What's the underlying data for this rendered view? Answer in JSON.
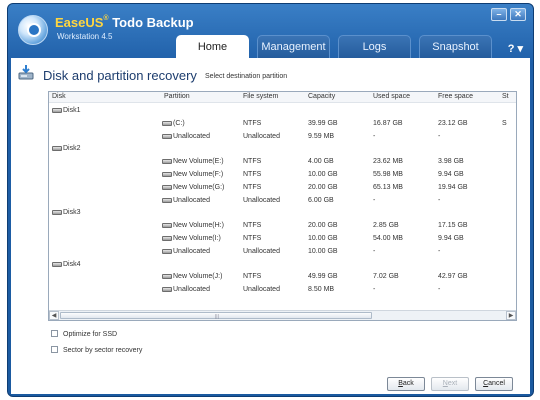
{
  "app": {
    "brand_easeus": "EaseUS",
    "brand_sup": "®",
    "brand_rest": " Todo Backup",
    "subtitle": "Workstation 4.5"
  },
  "window_controls": {
    "minimize": "–",
    "close": "✕"
  },
  "tabs": [
    {
      "label": "Home",
      "active": true
    },
    {
      "label": "Management",
      "active": false
    },
    {
      "label": "Logs",
      "active": false
    },
    {
      "label": "Snapshot",
      "active": false
    }
  ],
  "help_menu": "? ▾",
  "page": {
    "title": "Disk and partition recovery",
    "subtitle": "Select destination partition"
  },
  "grid": {
    "columns": [
      "Disk",
      "Partition",
      "File system",
      "Capacity",
      "Used space",
      "Free space",
      "St"
    ],
    "rows": [
      {
        "type": "disk",
        "disk": "Disk1"
      },
      {
        "type": "part",
        "partition": "(C:)",
        "fs": "NTFS",
        "capacity": "39.99 GB",
        "used": "16.87 GB",
        "free": "23.12 GB",
        "status": "S"
      },
      {
        "type": "part",
        "partition": "Unallocated",
        "fs": "Unallocated",
        "capacity": "9.59 MB",
        "used": "-",
        "free": "-",
        "status": ""
      },
      {
        "type": "disk",
        "disk": "Disk2"
      },
      {
        "type": "part",
        "partition": "New Volume(E:)",
        "fs": "NTFS",
        "capacity": "4.00 GB",
        "used": "23.62 MB",
        "free": "3.98 GB",
        "status": ""
      },
      {
        "type": "part",
        "partition": "New Volume(F:)",
        "fs": "NTFS",
        "capacity": "10.00 GB",
        "used": "55.98 MB",
        "free": "9.94 GB",
        "status": ""
      },
      {
        "type": "part",
        "partition": "New Volume(G:)",
        "fs": "NTFS",
        "capacity": "20.00 GB",
        "used": "65.13 MB",
        "free": "19.94 GB",
        "status": ""
      },
      {
        "type": "part",
        "partition": "Unallocated",
        "fs": "Unallocated",
        "capacity": "6.00 GB",
        "used": "-",
        "free": "-",
        "status": ""
      },
      {
        "type": "disk",
        "disk": "Disk3"
      },
      {
        "type": "part",
        "partition": "New Volume(H:)",
        "fs": "NTFS",
        "capacity": "20.00 GB",
        "used": "2.85 GB",
        "free": "17.15 GB",
        "status": ""
      },
      {
        "type": "part",
        "partition": "New Volume(I:)",
        "fs": "NTFS",
        "capacity": "10.00 GB",
        "used": "54.00 MB",
        "free": "9.94 GB",
        "status": ""
      },
      {
        "type": "part",
        "partition": "Unallocated",
        "fs": "Unallocated",
        "capacity": "10.00 GB",
        "used": "-",
        "free": "-",
        "status": ""
      },
      {
        "type": "disk",
        "disk": "Disk4"
      },
      {
        "type": "part",
        "partition": "New Volume(J:)",
        "fs": "NTFS",
        "capacity": "49.99 GB",
        "used": "7.02 GB",
        "free": "42.97 GB",
        "status": ""
      },
      {
        "type": "part",
        "partition": "Unallocated",
        "fs": "Unallocated",
        "capacity": "8.50 MB",
        "used": "-",
        "free": "-",
        "status": ""
      }
    ]
  },
  "options": {
    "optimize_ssd": {
      "label": "Optimize for SSD",
      "checked": false
    },
    "sector_by_sector": {
      "label": "Sector by sector recovery",
      "checked": false
    }
  },
  "buttons": {
    "back": {
      "mnemonic": "B",
      "rest": "ack",
      "enabled": true
    },
    "next": {
      "mnemonic": "N",
      "rest": "ext",
      "enabled": false
    },
    "cancel": {
      "mnemonic": "C",
      "rest": "ancel",
      "enabled": true
    }
  },
  "colors": {
    "title_bar": "#1f5fa8",
    "brand_accent": "#ffd640",
    "title_text": "#1d3d6e"
  }
}
